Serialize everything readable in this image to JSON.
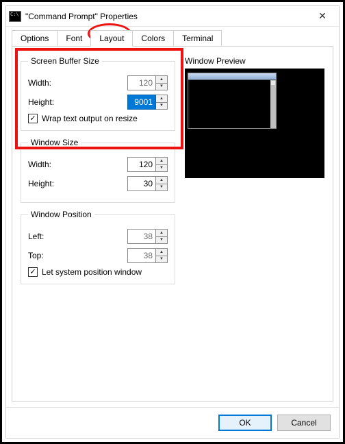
{
  "window": {
    "title": "\"Command Prompt\" Properties"
  },
  "tabs": {
    "t0": "Options",
    "t1": "Font",
    "t2": "Layout",
    "t3": "Colors",
    "t4": "Terminal"
  },
  "buffer": {
    "legend": "Screen Buffer Size",
    "width_label": "Width:",
    "width_value": "120",
    "height_label": "Height:",
    "height_value": "9001",
    "wrap_label": "Wrap text output on resize"
  },
  "winsize": {
    "legend": "Window Size",
    "width_label": "Width:",
    "width_value": "120",
    "height_label": "Height:",
    "height_value": "30"
  },
  "winpos": {
    "legend": "Window Position",
    "left_label": "Left:",
    "left_value": "38",
    "top_label": "Top:",
    "top_value": "38",
    "auto_label": "Let system position window"
  },
  "preview": {
    "label": "Window Preview"
  },
  "buttons": {
    "ok": "OK",
    "cancel": "Cancel"
  }
}
